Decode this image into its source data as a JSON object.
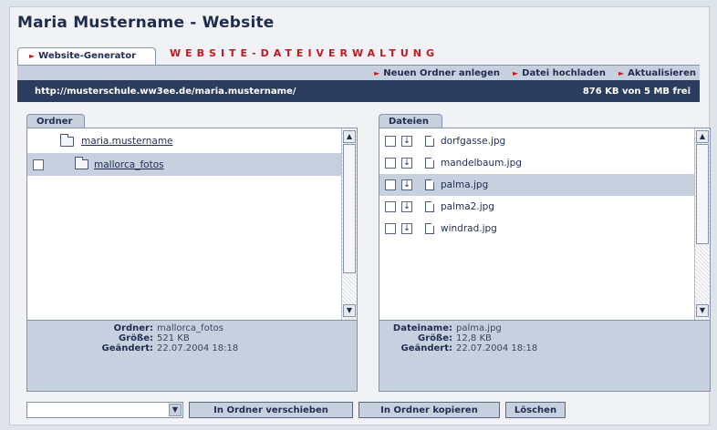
{
  "page": {
    "title": "Maria Mustername - Website"
  },
  "tabs": {
    "generator_label": "Website-Generator",
    "verwaltung_label": "WEBSITE-DATEIVERWALTUNG"
  },
  "toolbar": {
    "new_folder": "Neuen Ordner anlegen",
    "upload": "Datei hochladen",
    "refresh": "Aktualisieren"
  },
  "urlbar": {
    "url": "http://musterschule.ww3ee.de/maria.mustername/",
    "quota": "876 KB von 5 MB frei"
  },
  "folders": {
    "tab_label": "Ordner",
    "items": [
      {
        "name": "maria.mustername",
        "selected": false,
        "has_checkbox": false
      },
      {
        "name": "mallorca_fotos",
        "selected": true,
        "has_checkbox": true
      }
    ],
    "info": {
      "name_label": "Ordner:",
      "name_value": "mallorca_fotos",
      "size_label": "Größe:",
      "size_value": "521 KB",
      "changed_label": "Geändert:",
      "changed_value": "22.07.2004 18:18"
    }
  },
  "files": {
    "tab_label": "Dateien",
    "items": [
      {
        "name": "dorfgasse.jpg",
        "selected": false
      },
      {
        "name": "mandelbaum.jpg",
        "selected": false
      },
      {
        "name": "palma.jpg",
        "selected": true
      },
      {
        "name": "palma2.jpg",
        "selected": false
      },
      {
        "name": "windrad.jpg",
        "selected": false
      }
    ],
    "info": {
      "name_label": "Dateiname:",
      "name_value": "palma.jpg",
      "size_label": "Größe:",
      "size_value": "12,8 KB",
      "changed_label": "Geändert:",
      "changed_value": "22.07.2004 18:18"
    }
  },
  "actions": {
    "target_select_value": "",
    "move_label": "In Ordner verschieben",
    "copy_label": "In Ordner kopieren",
    "delete_label": "Löschen"
  },
  "colors": {
    "accent_red": "#c8161e",
    "navy": "#2c3c5e",
    "panel_blue": "#c7d0de"
  }
}
